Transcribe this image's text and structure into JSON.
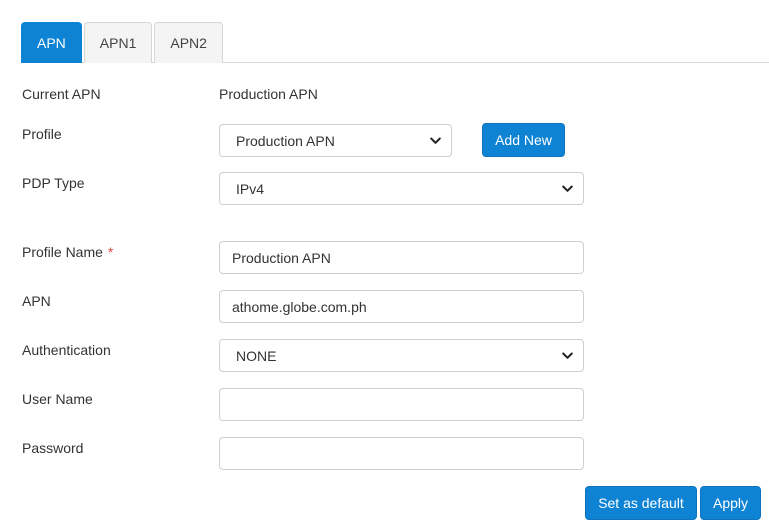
{
  "tabs": [
    {
      "label": "APN",
      "active": true
    },
    {
      "label": "APN1",
      "active": false
    },
    {
      "label": "APN2",
      "active": false
    }
  ],
  "form": {
    "current_apn": {
      "label": "Current APN",
      "value": "Production APN"
    },
    "profile": {
      "label": "Profile",
      "selected": "Production APN"
    },
    "add_new_label": "Add New",
    "pdp_type": {
      "label": "PDP Type",
      "selected": "IPv4"
    },
    "profile_name": {
      "label": "Profile Name",
      "required_mark": "*",
      "value": "Production APN"
    },
    "apn": {
      "label": "APN",
      "value": "athome.globe.com.ph"
    },
    "authentication": {
      "label": "Authentication",
      "selected": "NONE"
    },
    "user_name": {
      "label": "User Name",
      "value": ""
    },
    "password": {
      "label": "Password",
      "value": ""
    }
  },
  "actions": {
    "set_default_label": "Set as default",
    "apply_label": "Apply"
  },
  "colors": {
    "accent": "#0e83d4",
    "required": "#e0463a"
  },
  "icons": {
    "dropdown": "chevron-down-icon"
  }
}
